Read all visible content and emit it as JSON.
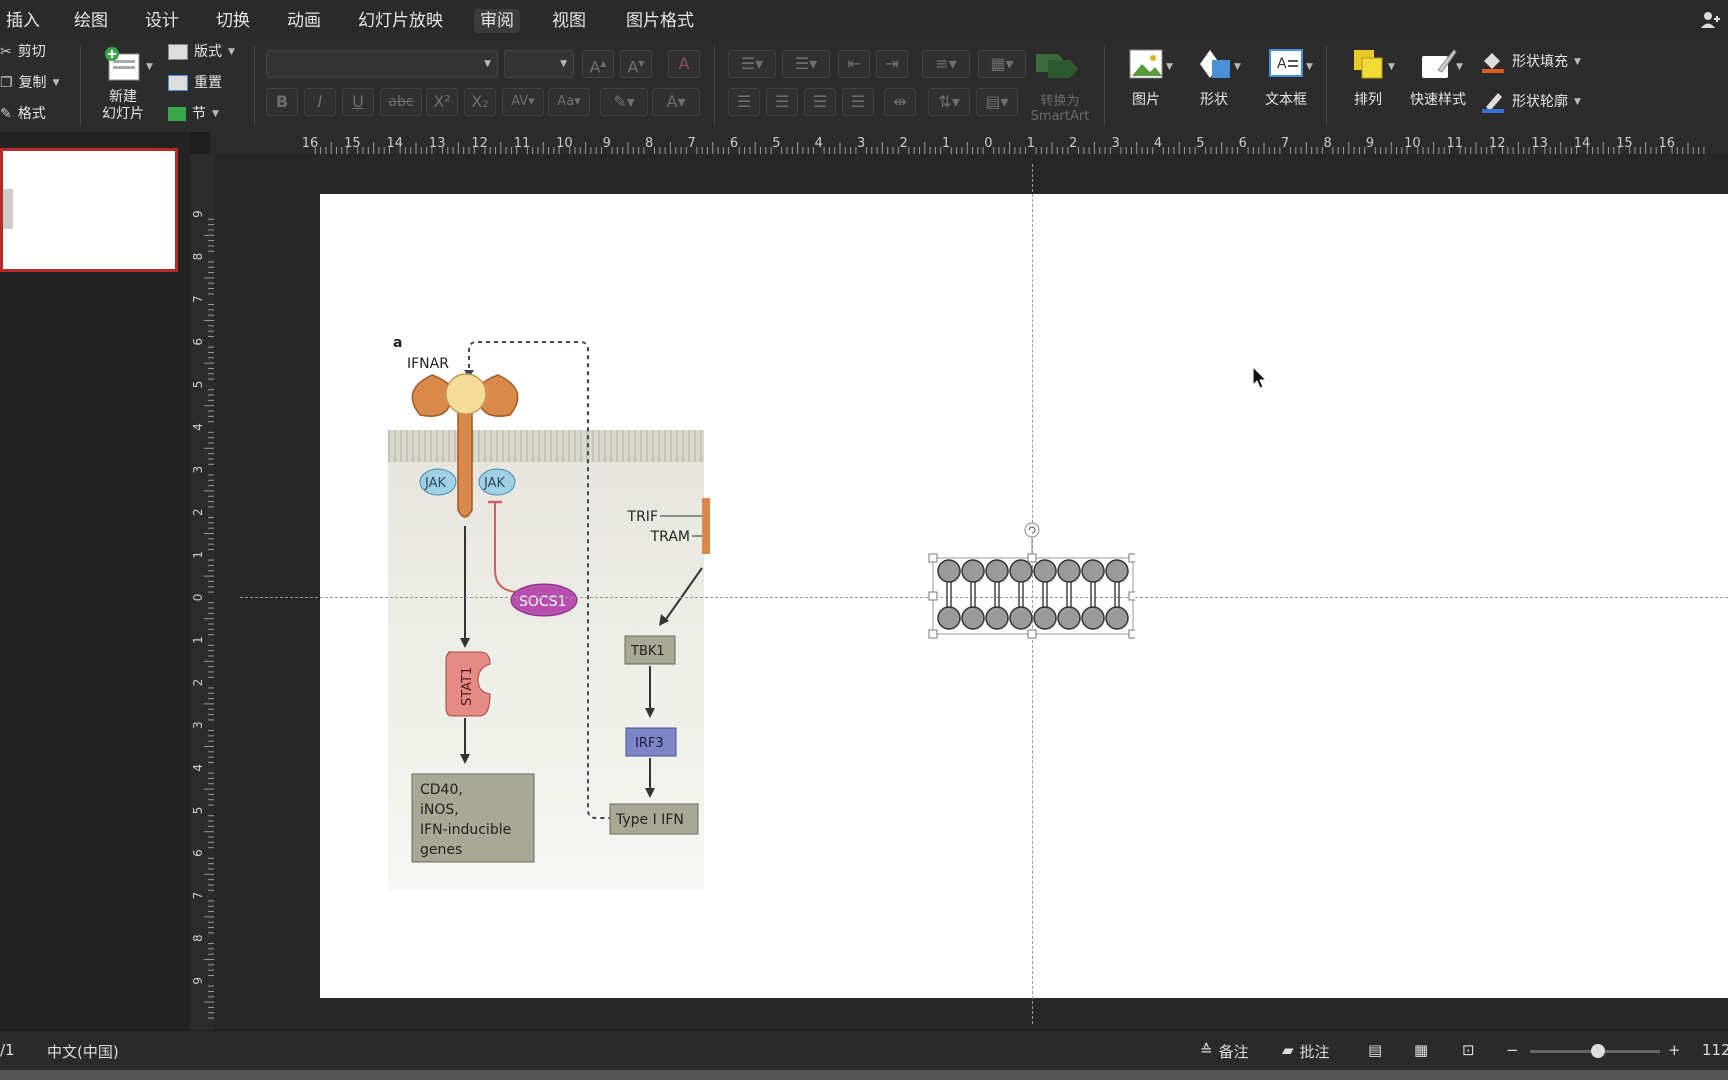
{
  "menu": {
    "tabs": [
      {
        "label": "插入"
      },
      {
        "label": "绘图"
      },
      {
        "label": "设计"
      },
      {
        "label": "切换"
      },
      {
        "label": "动画"
      },
      {
        "label": "幻灯片放映"
      },
      {
        "label": "审阅"
      },
      {
        "label": "视图"
      },
      {
        "label": "图片格式"
      }
    ]
  },
  "ribbon": {
    "clipboard": {
      "cut": "剪切",
      "copy": "复制",
      "format": "格式"
    },
    "slides": {
      "new_slide_line1": "新建",
      "new_slide_line2": "幻灯片",
      "layout": "版式",
      "reset": "重置",
      "section": "节"
    },
    "paragraph": {
      "convert_line1": "转换为",
      "convert_line2": "SmartArt"
    },
    "insert": {
      "picture": "图片",
      "shape": "形状",
      "textbox": "文本框"
    },
    "arrange": {
      "arrange": "排列",
      "quick_styles": "快速样式",
      "shape_fill": "形状填充",
      "shape_outline": "形状轮廓"
    },
    "font_buttons": [
      "B",
      "I",
      "U",
      "abc",
      "X²",
      "X₂"
    ]
  },
  "ruler": {
    "top_labels": [
      "16",
      "15",
      "14",
      "13",
      "12",
      "11",
      "10",
      "9",
      "8",
      "7",
      "6",
      "5",
      "4",
      "3",
      "2",
      "1",
      "0",
      "1",
      "2",
      "3",
      "4",
      "5",
      "6",
      "7",
      "8",
      "9",
      "10",
      "11",
      "12",
      "13",
      "14",
      "15",
      "16"
    ],
    "left_labels": [
      "9",
      "8",
      "7",
      "6",
      "5",
      "4",
      "3",
      "2",
      "1",
      "0",
      "1",
      "2",
      "3",
      "4",
      "5",
      "6",
      "7",
      "8",
      "9"
    ]
  },
  "diagram": {
    "panel_label": "a",
    "ifnar": "IFNAR",
    "jak1": "JAK",
    "jak2": "JAK",
    "socs1": "SOCS1",
    "stat1": "STAT1",
    "genes": [
      "CD40,",
      "iNOS,",
      "IFN-inducible",
      "genes"
    ],
    "trif": "TRIF",
    "tram": "TRAM",
    "tbk1": "TBK1",
    "irf3": "IRF3",
    "type1ifn": "Type I IFN"
  },
  "status": {
    "slide_count": "/1",
    "language": "中文(中国)",
    "notes": "备注",
    "comments": "批注",
    "zoom": "112"
  },
  "colors": {
    "accent_border": "#b72a2a",
    "receptor": "#d98a4a",
    "jak": "#9fd0e3",
    "socs": "#b84fb0",
    "stat": "#e58a86",
    "tbk": "#a8a894",
    "irf3": "#7f86c8"
  }
}
